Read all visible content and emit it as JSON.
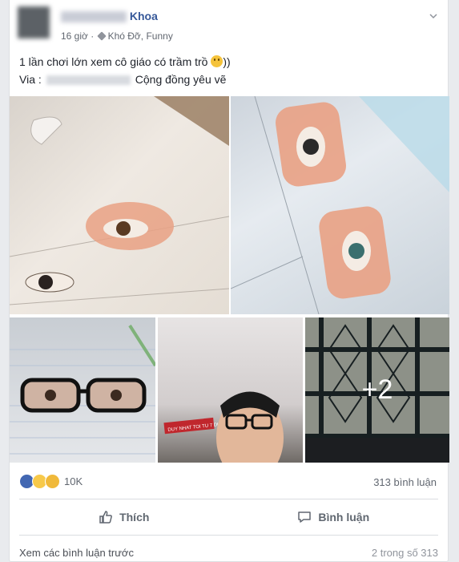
{
  "post": {
    "author_visible": "Khoa",
    "time": "16 giờ",
    "separator": "·",
    "tag_text": "Khó Đỡ, Funny",
    "line1": "1 lần chơi lớn xem cô giáo có trầm trồ",
    "line1_suffix": "))",
    "via_prefix": "Via :",
    "via_page": "Cộng đồng yêu vẽ",
    "more_photos": "+2",
    "poster_text": "DUY NHAT TOI TU 7 DU GU"
  },
  "stats": {
    "reaction_icons": [
      "like-icon",
      "haha-icon",
      "wow-icon"
    ],
    "reactions": "10K",
    "comments": "313 bình luận"
  },
  "actions": {
    "like": "Thích",
    "comment": "Bình luận"
  },
  "footer": {
    "view_previous": "Xem các bình luận trước",
    "pagination": "2 trong số 313"
  },
  "colors": {
    "link": "#365899",
    "like_blue": "#4267b2"
  }
}
